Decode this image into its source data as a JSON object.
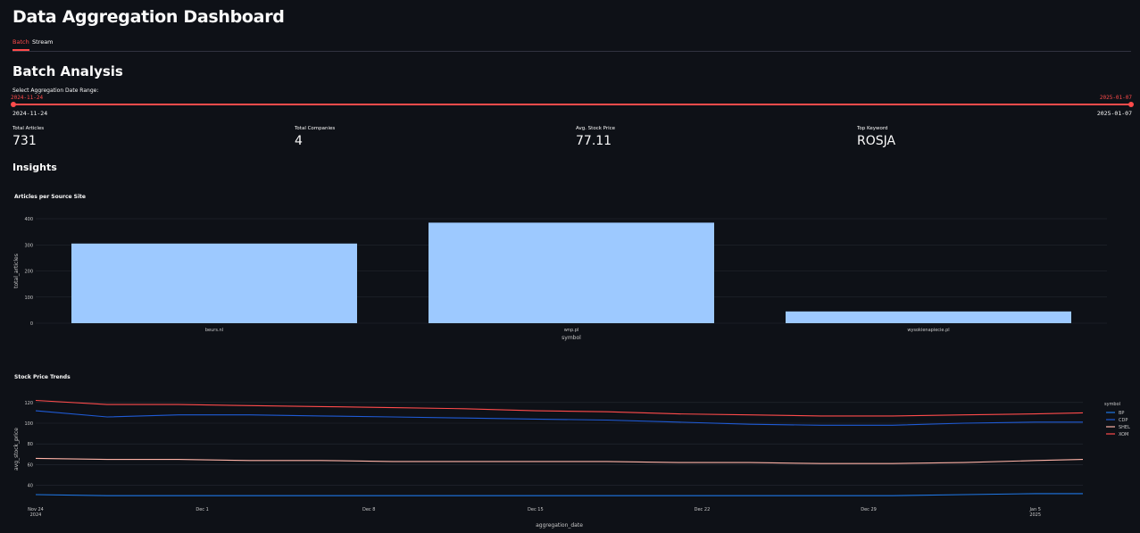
{
  "header": {
    "title": "Data Aggregation Dashboard"
  },
  "tabs": [
    {
      "label": "Batch",
      "active": true
    },
    {
      "label": "Stream",
      "active": false
    }
  ],
  "batch": {
    "heading": "Batch Analysis",
    "date_range": {
      "label": "Select Aggregation Date Range:",
      "start": "2024-11-24",
      "end": "2025-01-07",
      "min": "2024-11-24",
      "max": "2025-01-07"
    },
    "metrics": [
      {
        "label": "Total Articles",
        "value": "731"
      },
      {
        "label": "Total Companies",
        "value": "4"
      },
      {
        "label": "Avg. Stock Price",
        "value": "77.11"
      },
      {
        "label": "Top Keyword",
        "value": "ROSJA"
      }
    ],
    "insights_heading": "Insights"
  },
  "colors": {
    "accent": "#ff4b4b",
    "bar": "#9dc9ff",
    "BP": "#1f77e5",
    "CDP": "#1f5bd6",
    "SHEL": "#ffb3a7",
    "XOM": "#ff4b4b"
  },
  "chart_data": [
    {
      "type": "bar",
      "title": "Articles per Source Site",
      "xlabel": "symbol",
      "ylabel": "total_articles",
      "categories": [
        "beurs.nl",
        "wnp.pl",
        "wysokienapiecie.pl"
      ],
      "values": [
        305,
        385,
        45
      ],
      "ylim": [
        0,
        400
      ],
      "yticks": [
        "0",
        "100",
        "200",
        "300",
        "400"
      ],
      "grid": true
    },
    {
      "type": "line",
      "title": "Stock Price Trends",
      "xlabel": "aggregation_date",
      "ylabel": "avg_stock_price",
      "legend_title": "symbol",
      "legend_position": "right",
      "x": [
        "2024-11-24",
        "2024-11-27",
        "2024-11-30",
        "2024-12-03",
        "2024-12-06",
        "2024-12-09",
        "2024-12-12",
        "2024-12-15",
        "2024-12-18",
        "2024-12-21",
        "2024-12-24",
        "2024-12-27",
        "2024-12-30",
        "2025-01-02",
        "2025-01-05",
        "2025-01-07"
      ],
      "xticks": [
        {
          "line1": "Nov 24",
          "line2": "2024"
        },
        {
          "line1": "Dec 1",
          "line2": ""
        },
        {
          "line1": "Dec 8",
          "line2": ""
        },
        {
          "line1": "Dec 15",
          "line2": ""
        },
        {
          "line1": "Dec 22",
          "line2": ""
        },
        {
          "line1": "Dec 29",
          "line2": ""
        },
        {
          "line1": "Jan 5",
          "line2": "2025"
        }
      ],
      "yticks": [
        "40",
        "60",
        "80",
        "100",
        "120"
      ],
      "ylim": [
        25,
        125
      ],
      "series": [
        {
          "name": "BP",
          "values": [
            31,
            30,
            30,
            30,
            30,
            30,
            30,
            30,
            30,
            30,
            30,
            30,
            30,
            31,
            32,
            32
          ]
        },
        {
          "name": "CDP",
          "values": [
            112,
            106,
            108,
            108,
            107,
            106,
            105,
            104,
            103,
            101,
            99,
            98,
            98,
            100,
            101,
            101
          ]
        },
        {
          "name": "SHEL",
          "values": [
            66,
            65,
            65,
            64,
            64,
            63,
            63,
            63,
            63,
            62,
            62,
            61,
            61,
            62,
            64,
            65
          ]
        },
        {
          "name": "XOM",
          "values": [
            122,
            118,
            118,
            117,
            116,
            115,
            114,
            112,
            111,
            109,
            108,
            107,
            107,
            108,
            109,
            110
          ]
        }
      ]
    }
  ]
}
